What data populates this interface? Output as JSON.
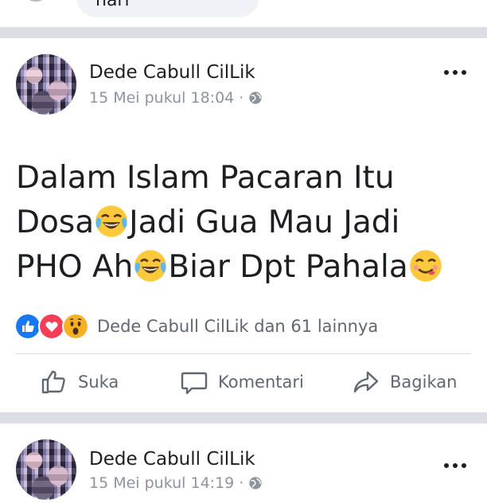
{
  "previous_comment": {
    "text": "nari"
  },
  "posts": [
    {
      "author": "Dede Cabull CilLik",
      "timestamp": "15 Mei pukul 18:04 ·",
      "privacy_icon": "globe-icon",
      "text_lines": [
        "Dalam Islam Pacaran Itu",
        "Dosa",
        "Jadi Gua Mau Jadi",
        "PHO Ah",
        "Biar Dpt Pahala"
      ],
      "emojis": [
        "tears-of-joy-emoji",
        "tears-of-joy-emoji",
        "yummy-face-emoji"
      ],
      "reactions": [
        "like",
        "love",
        "wow"
      ],
      "reaction_summary": "Dede Cabull CilLik dan 61 lainnya",
      "actions": {
        "like": "Suka",
        "comment": "Komentari",
        "share": "Bagikan"
      }
    },
    {
      "author": "Dede Cabull CilLik",
      "timestamp": "15 Mei pukul 14:19 ·",
      "privacy_icon": "globe-icon"
    }
  ],
  "colors": {
    "like_blue": "#1877f2",
    "love_red": "#f33e58",
    "wow_yellow": "#f7b125",
    "text": "#1c1e21",
    "muted": "#606770"
  }
}
